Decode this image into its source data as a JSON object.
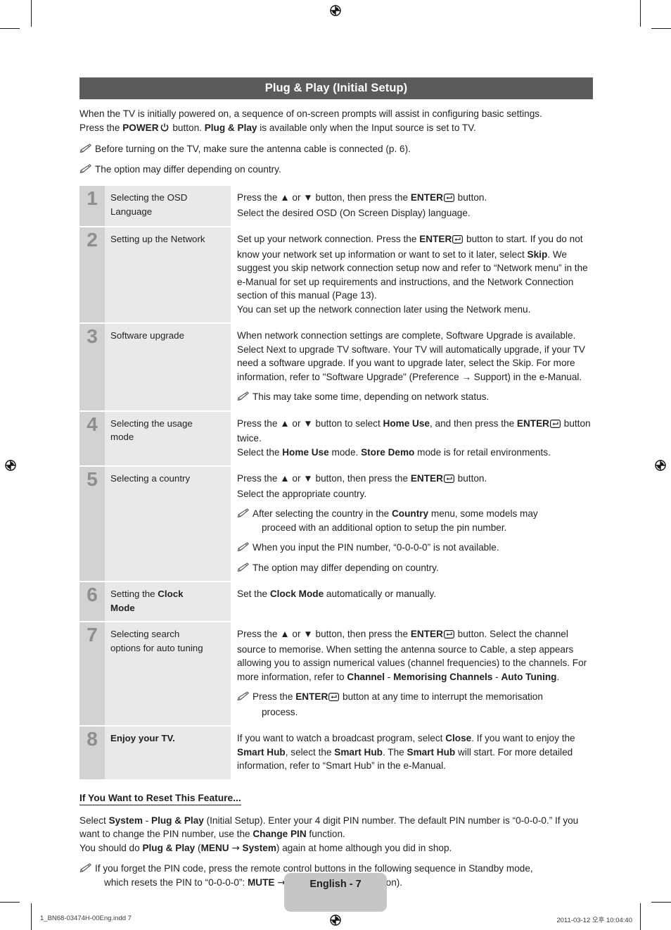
{
  "banner": {
    "title": "Plug & Play (Initial Setup)"
  },
  "intro": {
    "line1": "When the TV is initially powered on, a sequence of on-screen prompts will assist in configuring basic settings.",
    "line2_a": "Press the ",
    "line2_power": "POWER",
    "line2_power_icon": "power-symbol",
    "line2_b": " button. ",
    "line2_bold": "Plug & Play",
    "line2_c": " is available only when the Input source is set to TV."
  },
  "intro_notes": [
    "Before turning on the TV, make sure the antenna cable is connected (p. 6).",
    "The option may differ depending on country."
  ],
  "steps": [
    {
      "num": "1",
      "label": "Selecting the OSD Language",
      "lines": [
        "Press the ▲ or ▼ button, then press the ENTER↵ button.",
        "Select the desired OSD (On Screen Display) language."
      ]
    },
    {
      "num": "2",
      "label": "Setting up the Network",
      "lines": [
        "Set up your network connection. Press the ENTER↵ button to start. If you do not know your network set up information or want to set to it later, select Skip. We suggest you skip network connection setup now and refer to “Network menu” in the e-Manual for set up requirements and instructions, and the Network Connection section of this manual (Page 13).",
        "You can set up the network connection later using the Network menu."
      ]
    },
    {
      "num": "3",
      "label": "Software upgrade",
      "lines": [
        "When network connection settings are complete, Software Upgrade is available. Select Next to upgrade TV software. Your TV will automatically upgrade, if your TV need a software upgrade. If you want to upgrade later, select the Skip. For more information, refer to \"Software Upgrade\" (Preference → Support) in the e-Manual."
      ],
      "notes": [
        "This may take some time, depending on network status."
      ]
    },
    {
      "num": "4",
      "label": "Selecting the usage mode",
      "lines": [
        "Press the ▲ or ▼ button to select Home Use, and then press the ENTER↵ button twice.",
        "Select the Home Use mode. Store Demo mode is for retail environments."
      ]
    },
    {
      "num": "5",
      "label": "Selecting a country",
      "lines": [
        "Press the ▲ or ▼ button, then press the ENTER↵ button.",
        "Select the appropriate country."
      ],
      "notes": [
        "After selecting the country in the Country menu, some models may proceed with an additional option to setup the pin number.",
        "When you input the PIN number, “0-0-0-0” is not available.",
        "The option may differ depending on country."
      ]
    },
    {
      "num": "6",
      "label": "Setting the Clock Mode",
      "lines": [
        "Set the Clock Mode automatically or manually."
      ]
    },
    {
      "num": "7",
      "label": "Selecting search options for auto tuning",
      "lines": [
        "Press the ▲ or ▼ button, then press the ENTER↵ button. Select the channel source to memorise. When setting the antenna source to Cable, a step appears allowing you to assign numerical values (channel frequencies) to the channels. For more information, refer to Channel - Memorising Channels - Auto Tuning."
      ],
      "notes": [
        "Press the ENTER↵ button at any time to interrupt the memorisation process."
      ]
    },
    {
      "num": "8",
      "label": "Enjoy your TV.",
      "lines": [
        "If you want to watch a broadcast program, select Close. If you want to enjoy the Smart Hub, select the Smart Hub. The Smart Hub will start. For more detailed information, refer to “Smart Hub” in the e-Manual."
      ]
    }
  ],
  "reset": {
    "heading": "If You Want to Reset This Feature...",
    "line1": "Select System - Plug & Play (Initial Setup). Enter your 4 digit PIN number. The default PIN number is “0-0-0-0.” If you want to change the PIN number, use the Change PIN function.",
    "line2": "You should do Plug & Play (MENU → System) again at home although you did in shop.",
    "note": "If you forget the PIN code, press the remote control buttons in the following sequence in Standby mode, which resets the PIN to “0-0-0-0”: MUTE → 8 → 2 → 4 → POWER (on)."
  },
  "footer": {
    "page_badge": "English - 7",
    "print_file": "1_BN68-03474H-00Eng.indd   7",
    "print_timestamp": "2011-03-12   오후 10:04:40"
  },
  "colors": {
    "banner_bg": "#5b5b5b",
    "num_cell_bg": "#d2d2d2",
    "label_cell_bg": "#e9e9e9",
    "page_badge_bg": "#c6c6c6",
    "text": "#231f20"
  }
}
